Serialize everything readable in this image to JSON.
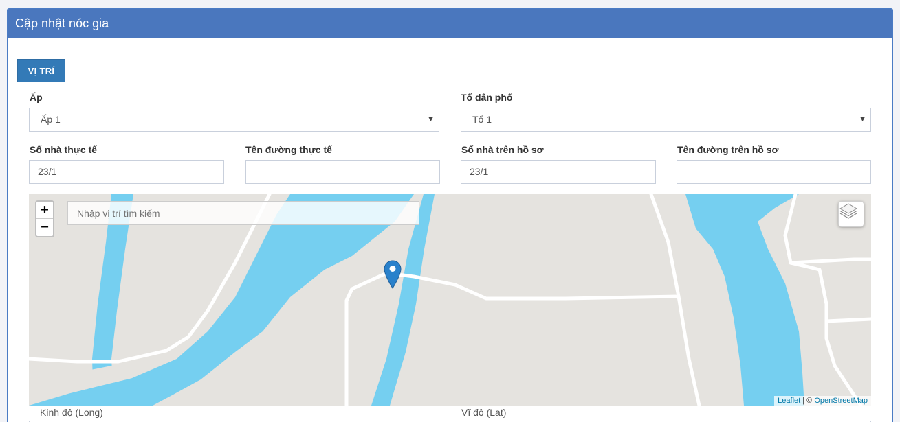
{
  "panel": {
    "title": "Cập nhật nóc gia"
  },
  "tabs": {
    "position_label": "VỊ TRÍ"
  },
  "form": {
    "ap": {
      "label": "Ấp",
      "value": "Ấp 1"
    },
    "to_dan_pho": {
      "label": "Tổ dân phố",
      "value": "Tổ 1"
    },
    "so_nha_thuc_te": {
      "label": "Số nhà thực tế",
      "value": "23/1"
    },
    "ten_duong_thuc_te": {
      "label": "Tên đường thực tế",
      "value": ""
    },
    "so_nha_ho_so": {
      "label": "Số nhà trên hồ sơ",
      "value": "23/1"
    },
    "ten_duong_ho_so": {
      "label": "Tên đường trên hồ sơ",
      "value": ""
    },
    "kinh_do": {
      "label": "Kinh độ (Long)"
    },
    "vi_do": {
      "label": "Vĩ độ (Lat)"
    }
  },
  "map": {
    "search_placeholder": "Nhập vị trí tìm kiếm",
    "zoom_in": "+",
    "zoom_out": "−",
    "attribution_leaflet": "Leaflet",
    "attribution_sep": " | © ",
    "attribution_osm": "OpenStreetMap",
    "marker_icon": "map-marker-icon",
    "layers_icon": "layers-icon",
    "colors": {
      "land": "#e5e3df",
      "water": "#75cff0",
      "road": "#ffffff",
      "marker": "#2a81cb"
    }
  }
}
